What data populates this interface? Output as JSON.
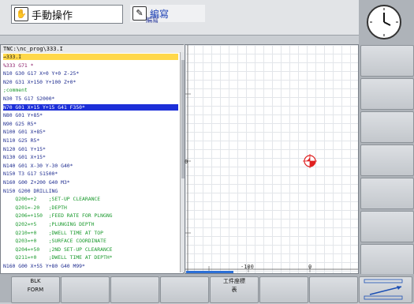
{
  "header": {
    "mode_left": "手動操作",
    "mode_right": "編寫",
    "mode_right_sub": "編寫"
  },
  "program": {
    "path": "TNC:\\nc_prog\\333.I",
    "lines": [
      "→333.I",
      "%333 G71 *",
      "N10 G30 G17 X+0 Y+0 Z-25*",
      "N20 G31 X+150 Y+100 Z+0*",
      ";comment",
      "N30 T5 G17 S2000*",
      "N70 G01 X+15 Y+15 G41 F350*",
      "N80 G01 Y+85*",
      "N90 G25 R5*",
      "N100 G01 X+85*",
      "N110 G25 R5*",
      "N120 G01 Y+15*",
      "N130 G01 X+15*",
      "N140 G01 X-30 Y-30 G40*",
      "N150 T3 G17 S1500*",
      "N160 G00 Z+200 G40 M3*",
      "N150 G200 DRILLING",
      "    Q200=+2    ;SET-UP CLEARANCE",
      "    Q201=-20   ;DEPTH",
      "    Q206=+150  ;FEED RATE FOR PLNGNG",
      "    Q202=+5    ;PLUNGING DEPTH",
      "    Q210=+0    ;DWELL TIME AT TOP",
      "    Q203=+0    ;SURFACE COORDINATE",
      "    Q204=+50   ;2ND SET-UP CLEARANCE",
      "    Q211=+0    ;DWELL TIME AT DEPTH*",
      "N160 G00 X+55 Y+80 G40 M99*"
    ]
  },
  "graphic": {
    "x_label_left": "-100",
    "x_label_right": "0",
    "y_label": "0"
  },
  "softkeys": {
    "blk_line1": "BLK",
    "blk_line2": "FORM",
    "datum_line1": "工件座標",
    "datum_line2": "表"
  },
  "icons": [
    "hand-icon",
    "edit-icon",
    "clock-icon",
    "target-icon",
    "arrow-icon"
  ],
  "colors": {
    "highlight_yellow": "#ffd84a",
    "highlight_blue": "#1c2fd8",
    "comment_green": "#1b9a2e"
  }
}
